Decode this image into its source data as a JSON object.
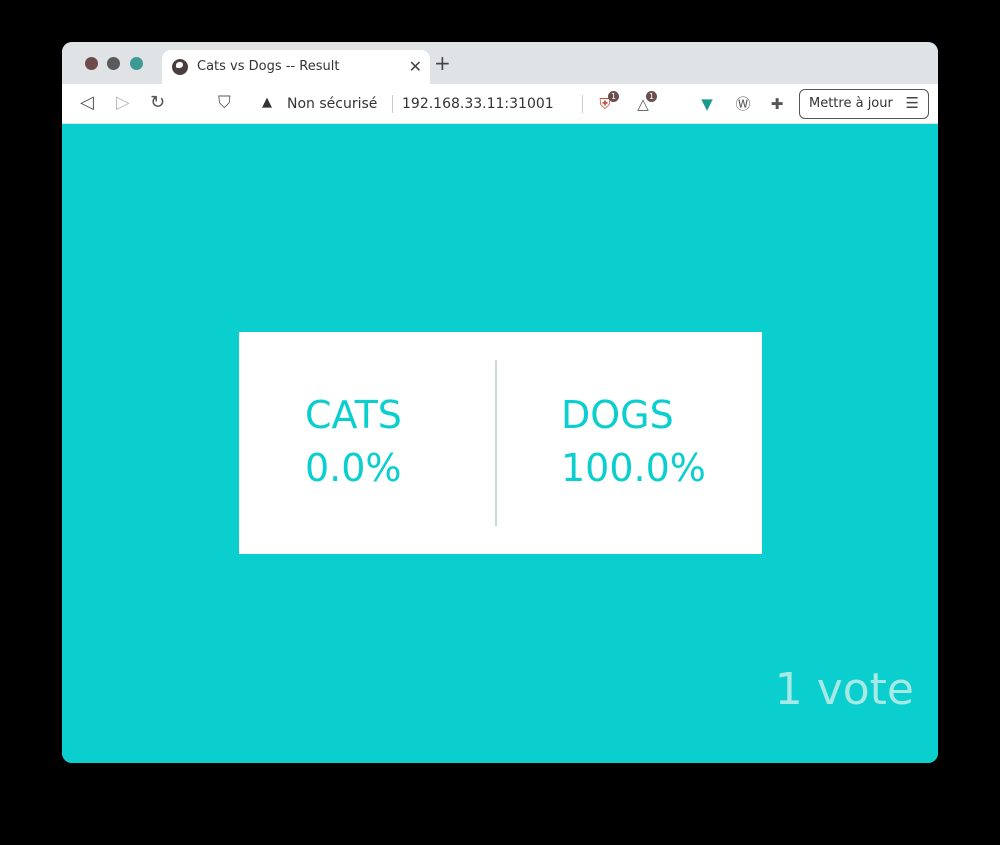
{
  "browser": {
    "tab_title": "Cats vs Dogs -- Result",
    "tab_close": "✕",
    "new_tab": "+",
    "security_label": "Non sécurisé",
    "url": "192.168.33.11:31001",
    "update_label": "Mettre à jour",
    "ext_badge_1": "1",
    "ext_badge_2": "1"
  },
  "result": {
    "option_a": {
      "name": "CATS",
      "percent": "0.0%"
    },
    "option_b": {
      "name": "DOGS",
      "percent": "100.0%"
    },
    "vote_count": "1 vote"
  },
  "colors": {
    "accent": "#0bcece",
    "card": "#ffffff"
  }
}
